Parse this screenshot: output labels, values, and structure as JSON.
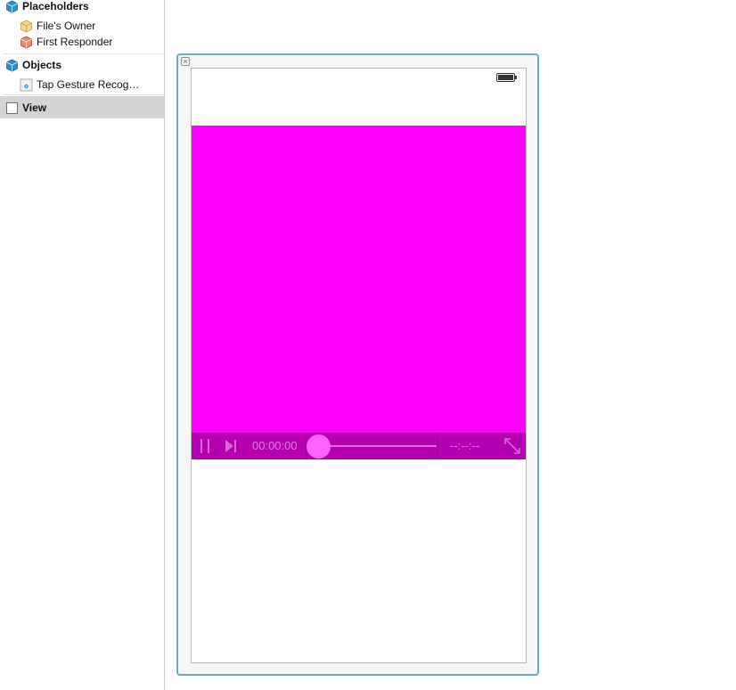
{
  "outline": {
    "placeholders": {
      "title": "Placeholders",
      "items": [
        {
          "label": "File's Owner",
          "icon": "files-owner-cube-icon"
        },
        {
          "label": "First Responder",
          "icon": "first-responder-cube-icon"
        }
      ]
    },
    "objects": {
      "title": "Objects",
      "items": [
        {
          "label": "Tap Gesture Recog…",
          "icon": "tap-gesture-recognizer-icon"
        }
      ]
    },
    "view": {
      "label": "View",
      "icon": "view-icon",
      "selected": true
    }
  },
  "canvas": {
    "movie_background": "#ff00ff",
    "controls_background": "#b400b0",
    "accent": "#6fa8c8",
    "player": {
      "elapsed": "00:00:00",
      "remaining": "--:--:--",
      "progress": 0
    }
  }
}
